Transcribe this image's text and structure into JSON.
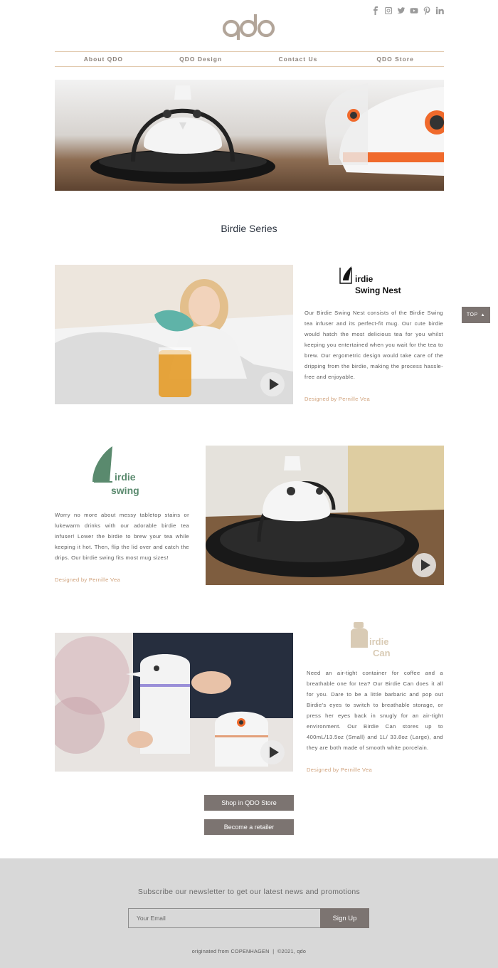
{
  "header": {
    "logo_text": "qdo",
    "social_icons": [
      "facebook-icon",
      "instagram-icon",
      "twitter-icon",
      "youtube-icon",
      "pinterest-icon",
      "linkedin-icon"
    ]
  },
  "nav": {
    "items": [
      "About QDO",
      "QDO Design",
      "Contact Us",
      "QDO Store"
    ]
  },
  "main": {
    "section_title": "Birdie Series",
    "products": [
      {
        "brand_line1": "irdie",
        "brand_line2": "Swing Nest",
        "description": "Our Birdie Swing Nest consists of the Birdie Swing tea infuser and its perfect-fit mug. Our cute birdie would hatch the most delicious tea for you whilst keeping you entertained when you wait for the tea to brew. Our ergometric design would take care of the dripping from the birdie, making the process hassle-free and enjoyable.",
        "designer": "Designed by Pernille Vea"
      },
      {
        "brand_line1": "irdie",
        "brand_line2": "swing",
        "description": "Worry no more about messy tabletop stains or lukewarm drinks with our adorable birdie tea infuser! Lower the birdie to brew your tea while keeping it hot. Then, flip the lid over and catch the drips. Our birdie swing fits most mug sizes!",
        "designer": "Designed by Pernille Vea"
      },
      {
        "brand_line1": "irdie",
        "brand_line2": "Can",
        "description": "Need an air-tight container for coffee and a breathable one for tea? Our Birdie Can does it all for you. Dare to be a little barbaric and pop out Birdie's eyes to switch to breathable storage, or press her eyes back in snugly for an air-tight environment. Our Birdie Can stores up to 400mL/13.5oz (Small) and 1L/ 33.8oz (Large), and they are both made of smooth white porcelain.",
        "designer": "Designed by Pernille Vea"
      }
    ],
    "shop_button": "Shop in QDO Store",
    "retailer_button": "Become a retailer",
    "top_button": "TOP"
  },
  "footer": {
    "newsletter_text": "Subscribe our newsletter to get our latest news and promotions",
    "email_placeholder": "Your Email",
    "signup_label": "Sign Up",
    "copyright": "originated from COPENHAGEN  |  ©2021, qdo"
  },
  "colors": {
    "accent": "#7c7471",
    "divider": "#e2c9ae",
    "designer_text": "#d0a27c",
    "brand_green": "#5a8a6e",
    "brand_sand": "#d9cbb5",
    "footer_bg": "#d8d8d8"
  }
}
